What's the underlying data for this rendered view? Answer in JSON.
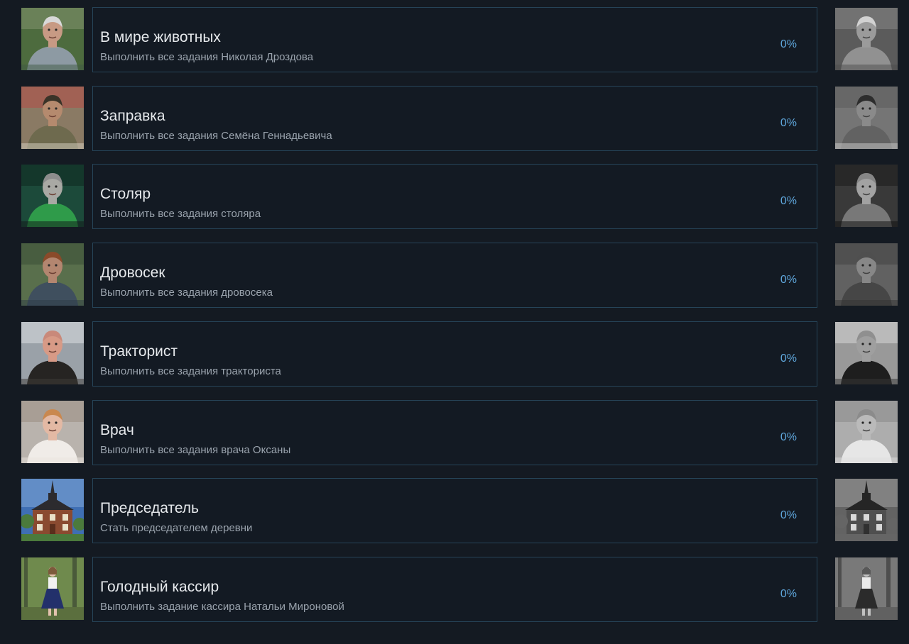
{
  "achievements": [
    {
      "title": "В мире животных",
      "description": "Выполнить все задания Николая Дроздова",
      "progress": "0%",
      "image": "man-in-camo-shirt-portrait",
      "palette": {
        "bg": "#4d6b3e",
        "bg2": "#7e8f6a",
        "body": "#8d9aa3",
        "skin": "#c79a84",
        "hair": "#d8d8d8",
        "accent": "#3f5a44"
      }
    },
    {
      "title": "Заправка",
      "description": "Выполнить все задания Семёна Геннадьевича",
      "progress": "0%",
      "image": "man-at-gas-station-portrait",
      "palette": {
        "bg": "#8a7a64",
        "bg2": "#b0504a",
        "body": "#6e6a4e",
        "skin": "#b58a6e",
        "hair": "#3a3328",
        "accent": "#d7d2c4"
      }
    },
    {
      "title": "Столяр",
      "description": "Выполнить все задания столяра",
      "progress": "0%",
      "image": "carpenter-in-green-shirt-portrait",
      "palette": {
        "bg": "#1c4a3a",
        "bg2": "#0f2b22",
        "body": "#2f9b4a",
        "skin": "#a9a9a4",
        "hair": "#8d8d8d",
        "accent": "#101615"
      }
    },
    {
      "title": "Дровосек",
      "description": "Выполнить все задания дровосека",
      "progress": "0%",
      "image": "lumberjack-portrait",
      "palette": {
        "bg": "#596f4c",
        "bg2": "#3d5238",
        "body": "#3f4f5e",
        "skin": "#b38670",
        "hair": "#8a4a2a",
        "accent": "#2e3b45"
      }
    },
    {
      "title": "Тракторист",
      "description": "Выполнить все задания тракториста",
      "progress": "0%",
      "image": "bald-tractor-driver-portrait",
      "palette": {
        "bg": "#9aa1a8",
        "bg2": "#d6d9dc",
        "body": "#262422",
        "skin": "#d79a86",
        "hair": "#c9897a",
        "accent": "#3e3b38"
      }
    },
    {
      "title": "Врач",
      "description": "Выполнить все задания врача Оксаны",
      "progress": "0%",
      "image": "female-doctor-portrait",
      "palette": {
        "bg": "#b9b3ad",
        "bg2": "#9d8f86",
        "body": "#f0ece8",
        "skin": "#e3b9a4",
        "hair": "#c9884f",
        "accent": "#e9e3de"
      }
    },
    {
      "title": "Председатель",
      "description": "Стать председателем деревни",
      "progress": "0%",
      "image": "village-hall-building",
      "palette": {
        "bg": "#3f6fb3",
        "bg2": "#8fb2dd",
        "body": "#8a4a30",
        "skin": "#c28c5d",
        "hair": "#2c2b2e",
        "accent": "#4b7a3c"
      }
    },
    {
      "title": "Голодный кассир",
      "description": "Выполнить задание кассира Натальи Мироновой",
      "progress": "0%",
      "image": "cashier-woman-in-forest",
      "palette": {
        "bg": "#6f8a4d",
        "bg2": "#a9b88a",
        "body": "#23306b",
        "skin": "#e3c2ae",
        "hair": "#7c5a3b",
        "accent": "#f2f2f2"
      }
    }
  ]
}
